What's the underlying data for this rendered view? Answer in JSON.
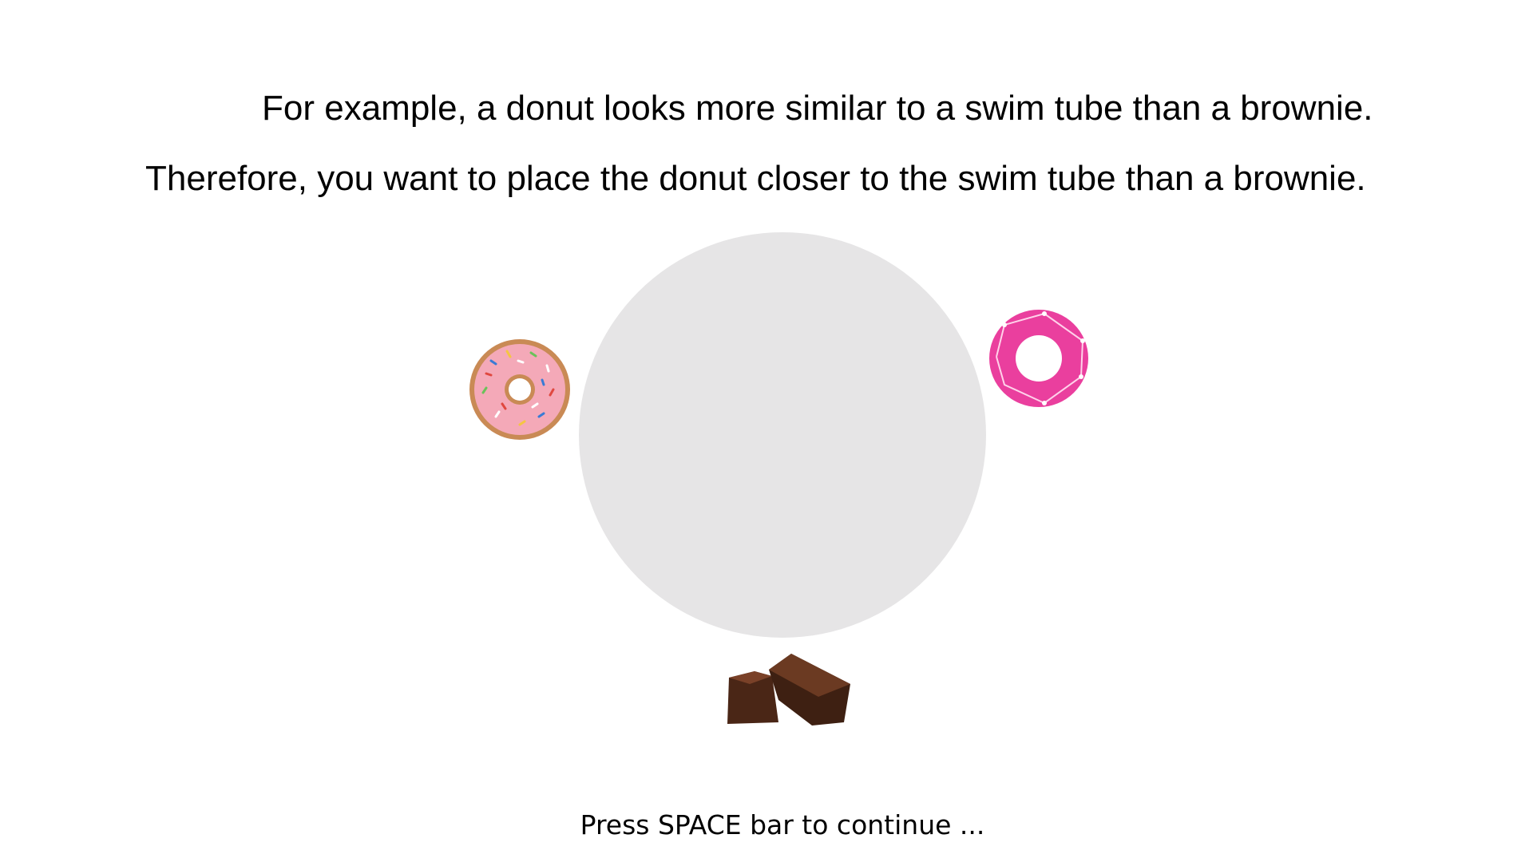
{
  "instructions": {
    "text": "For example, a donut looks more similar to a swim tube than a brownie. Therefore, you want to place the donut closer to the swim tube than a brownie."
  },
  "arena": {
    "color": "#e6e5e6"
  },
  "items": [
    {
      "name": "donut",
      "icon": "sprinkled-donut-image"
    },
    {
      "name": "swim tube",
      "icon": "pink-swim-ring-image"
    },
    {
      "name": "brownie",
      "icon": "brownie-image"
    }
  ],
  "footer": {
    "prompt": "Press SPACE bar to continue ..."
  }
}
